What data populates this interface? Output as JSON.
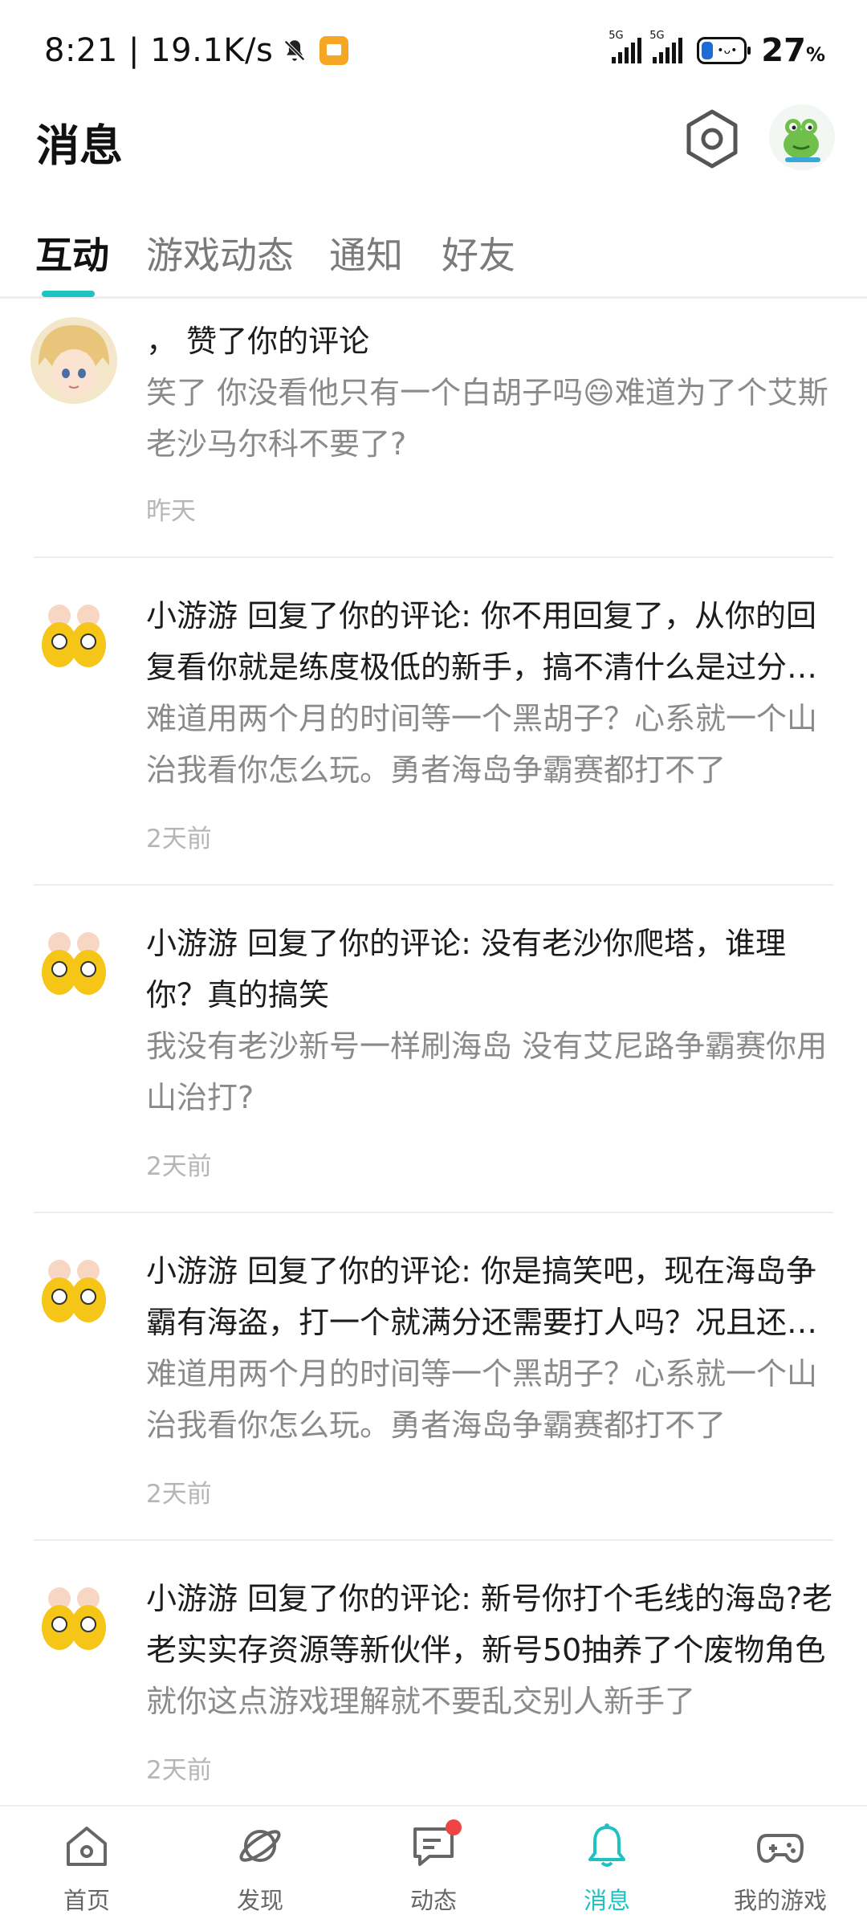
{
  "status_bar": {
    "left_text": "8:21 | 19.1K/s",
    "network_labels": [
      "5G",
      "5G"
    ],
    "battery_percent": "27",
    "battery_unit": "%"
  },
  "header": {
    "title": "消息"
  },
  "tabs": [
    {
      "label": "互动",
      "active": true
    },
    {
      "label": "游戏动态",
      "active": false
    },
    {
      "label": "通知",
      "active": false
    },
    {
      "label": "好友",
      "active": false
    }
  ],
  "messages": [
    {
      "title": "， 赞了你的评论",
      "body": "笑了 你没看他只有一个白胡子吗😄难道为了个艾斯 老沙马尔科不要了?",
      "time": "昨天"
    },
    {
      "title": "小游游 回复了你的评论: 你不用回复了，从你的回复看你就是练度极低的新手，搞不清什么是过分强度什么是版本答案就瞎说",
      "body": "难道用两个月的时间等一个黑胡子？心系就一个山治我看你怎么玩。勇者海岛争霸赛都打不了",
      "time": "2天前"
    },
    {
      "title": "小游游 回复了你的评论: 没有老沙你爬塔，谁理你？真的搞笑",
      "body": "我没有老沙新号一样刷海岛 没有艾尼路争霸赛你用山治打?",
      "time": "2天前"
    },
    {
      "title": "小游游 回复了你的评论: 你是搞笑吧，现在海岛争霸有海盗，打一个就满分还需要打人吗？况且还有别的",
      "body": "难道用两个月的时间等一个黑胡子？心系就一个山治我看你怎么玩。勇者海岛争霸赛都打不了",
      "time": "2天前"
    },
    {
      "title": "小游游 回复了你的评论: 新号你打个毛线的海岛?老老实实存资源等新伙伴，新号50抽养了个废物角色",
      "body": "就你这点游戏理解就不要乱交别人新手了",
      "time": "2天前"
    }
  ],
  "bottom_nav": [
    {
      "label": "首页",
      "icon": "home-icon",
      "active": false
    },
    {
      "label": "发现",
      "icon": "planet-icon",
      "active": false
    },
    {
      "label": "动态",
      "icon": "chat-icon",
      "active": false,
      "badge": true
    },
    {
      "label": "消息",
      "icon": "bell-icon",
      "active": true
    },
    {
      "label": "我的游戏",
      "icon": "gamepad-icon",
      "active": false
    }
  ],
  "colors": {
    "accent": "#1ec2c2",
    "badge": "#ef4444",
    "muted_text": "#8a8a8a",
    "time_text": "#b5b5b5"
  }
}
